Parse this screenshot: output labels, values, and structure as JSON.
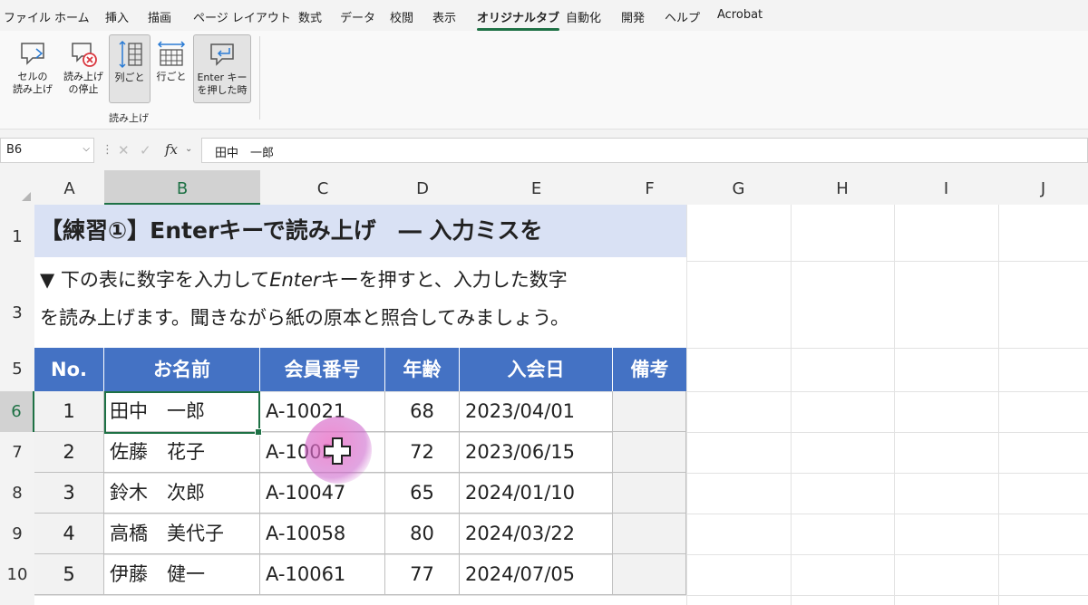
{
  "menu": [
    "ファイル",
    "ホーム",
    "挿入",
    "描画",
    "ページ レイアウト",
    "数式",
    "データ",
    "校閲",
    "表示",
    "オリジナルタブ",
    "自動化",
    "開発",
    "ヘルプ",
    "Acrobat"
  ],
  "active_menu": "オリジナルタブ",
  "ribbon": {
    "buttons": [
      {
        "line1": "セルの",
        "line2": "読み上げ",
        "icon": "speech-bubble-icon",
        "pressed": false
      },
      {
        "line1": "読み上げ",
        "line2": "の停止",
        "icon": "stop-speaking-icon",
        "pressed": false
      },
      {
        "line1": "列ごと",
        "line2": "",
        "icon": "by-column-icon",
        "pressed": true
      },
      {
        "line1": "行ごと",
        "line2": "",
        "icon": "by-row-icon",
        "pressed": false
      },
      {
        "line1": "Enter キー",
        "line2": "を押した時",
        "icon": "enter-speech-icon",
        "pressed": true
      }
    ],
    "group_label": "読み上げ"
  },
  "formula_bar": {
    "name_box": "B6",
    "fx": "fx",
    "value": "田中　一郎"
  },
  "columns": [
    "A",
    "B",
    "C",
    "D",
    "E",
    "F",
    "G",
    "H",
    "I",
    "J"
  ],
  "selected_column": "B",
  "rows": [
    "1",
    "3",
    "5",
    "6",
    "7",
    "8",
    "9",
    "10"
  ],
  "selected_row": "6",
  "sheet": {
    "title": "【練習①】Enterキーで読み上げ　― 入力ミスを",
    "instruction_line1_a": "▼ 下の表に数字を入力して",
    "instruction_line1_em": "Enter",
    "instruction_line1_b": "キーを押すと、入力した数字",
    "instruction_line2": "を読み上げます。聞きながら紙の原本と照合してみましょう。",
    "headers": [
      "No.",
      "お名前",
      "会員番号",
      "年齢",
      "入会日",
      "備考"
    ],
    "records": [
      [
        "1",
        "田中　一郎",
        "A-10021",
        "68",
        "2023/04/01",
        ""
      ],
      [
        "2",
        "佐藤　花子",
        "A-10034",
        "72",
        "2023/06/15",
        ""
      ],
      [
        "3",
        "鈴木　次郎",
        "A-10047",
        "65",
        "2024/01/10",
        ""
      ],
      [
        "4",
        "高橋　美代子",
        "A-10058",
        "80",
        "2024/03/22",
        ""
      ],
      [
        "5",
        "伊藤　健一",
        "A-10061",
        "77",
        "2024/07/05",
        ""
      ]
    ]
  },
  "colors": {
    "header_fill": "#4472c4",
    "title_fill": "#d9e1f4",
    "accent": "#1e7145"
  }
}
